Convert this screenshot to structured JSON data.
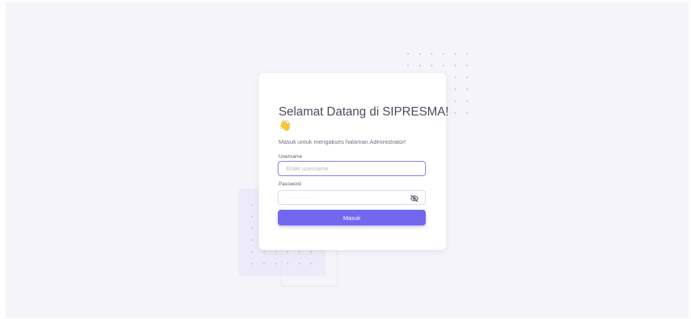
{
  "login": {
    "title": "Selamat Datang di SIPRESMA!",
    "wave_emoji": "👋",
    "subtitle": "Masuk untuk mengakses halaman Administrator!",
    "username": {
      "label": "Username",
      "placeholder": "Enter username"
    },
    "password": {
      "label": "Password",
      "placeholder": "············",
      "toggle_icon": "eye-off-icon"
    },
    "submit_label": "Masuk"
  },
  "colors": {
    "primary": "#7367f0",
    "background": "#f5f5f9",
    "card": "#ffffff",
    "title_text": "#4b4b5c"
  }
}
